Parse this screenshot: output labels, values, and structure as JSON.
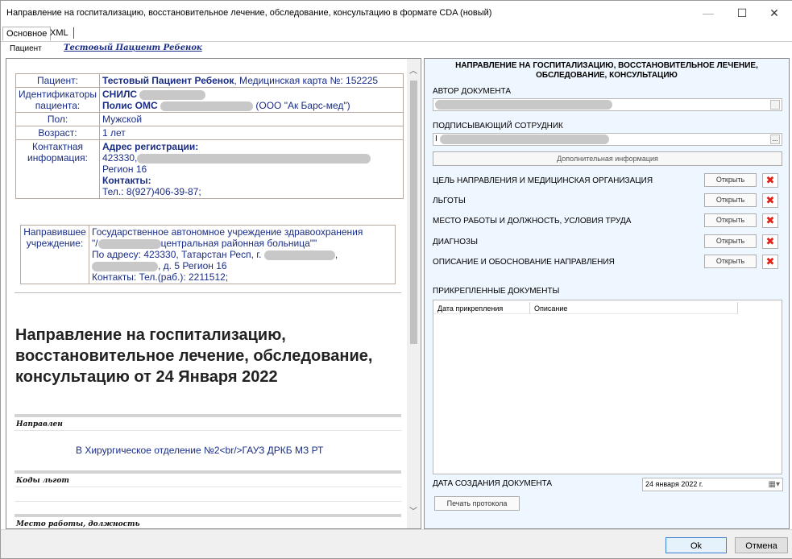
{
  "window": {
    "title": "Направление на госпитализацию, восстановительное лечение, обследование, консультацию в формате CDA (новый)",
    "controls": {
      "minimize": "—",
      "maximize": "☐",
      "close": "✕"
    }
  },
  "tabs": [
    {
      "label": "Основное",
      "active": true
    },
    {
      "label": "XML",
      "active": false
    }
  ],
  "patient_line": {
    "label": "Пациент",
    "value": "Тестовый Пациент Ребенок"
  },
  "left": {
    "patient_table": {
      "patient_key": "Пациент:",
      "patient_name": "Тестовый Пациент Ребенок",
      "patient_card": ", Медицинская карта №: 152225",
      "ids_key": "Идентификаторы пациента:",
      "snils": "СНИЛС",
      "oms": "Полис ОМС",
      "oms_org": "(ООО \"Ак Барс-мед\")",
      "sex_key": "Пол:",
      "sex": "Мужской",
      "age_key": "Возраст:",
      "age": "1 лет",
      "contact_key": "Контактная информация:",
      "addr_title": "Адрес регистрации:",
      "addr_zip": "423330,",
      "addr_region": "Регион 16",
      "contacts_title": "Контакты:",
      "phone": "Тел.: 8(927)406-39-87;"
    },
    "org_table": {
      "key": "Направившее учреждение:",
      "line1": "Государственное автономное учреждение здравоохранения",
      "line2_prefix": "\"/",
      "line2_suffix": "центральная районная больница\"\"",
      "line3": "По адресу: 423330, Татарстан Респ, г.",
      "line3_end": ",",
      "line4": ", д. 5 Регион 16",
      "line5": "Контакты: Тел.(раб.): 2211512;"
    },
    "big_title": "Направление на госпитализацию, восстановительное лечение, обследование, консультацию от 24 Января 2022",
    "sections": [
      {
        "heading": "Направлен",
        "text": "В Хирургическое отделение №2<br/>ГАУЗ ДРКБ МЗ РТ"
      },
      {
        "heading": "Коды льгот",
        "text": ""
      },
      {
        "heading": "Место работы, должность",
        "text": ""
      }
    ]
  },
  "right": {
    "heading": "НАПРАВЛЕНИЕ НА ГОСПИТАЛИЗАЦИЮ, ВОССТАНОВИТЕЛЬНОЕ ЛЕЧЕНИЕ, ОБСЛЕДОВАНИЕ, КОНСУЛЬТАЦИЮ",
    "author_label": "АВТОР ДОКУМЕНТА",
    "signer_label": "ПОДПИСЫВАЮЩИЙ СОТРУДНИК",
    "signer_prefix": "I",
    "ellipsis": "...",
    "additional_info": "Дополнительная информация",
    "rows": [
      {
        "label": "ЦЕЛЬ НАПРАВЛЕНИЯ И МЕДИЦИНСКАЯ ОРГАНИЗАЦИЯ",
        "open": "Открыть"
      },
      {
        "label": "ЛЬГОТЫ",
        "open": "Открыть"
      },
      {
        "label": "МЕСТО РАБОТЫ И ДОЛЖНОСТЬ, УСЛОВИЯ ТРУДА",
        "open": "Открыть"
      },
      {
        "label": "ДИАГНОЗЫ",
        "open": "Открыть"
      },
      {
        "label": "ОПИСАНИЕ И ОБОСНОВАНИЕ НАПРАВЛЕНИЯ",
        "open": "Открыть"
      }
    ],
    "attached_label": "ПРИКРЕПЛЕННЫЕ ДОКУМЕНТЫ",
    "attached_cols": [
      "Дата прикрепления",
      "Описание"
    ],
    "date_label": "ДАТА СОЗДАНИЯ ДОКУМЕНТА",
    "date_value": "24  января  2022 г.",
    "print_button": "Печать протокола"
  },
  "footer": {
    "ok": "Ok",
    "cancel": "Отмена"
  },
  "colors": {
    "link_blue": "#1a2d86",
    "delete_red": "#e2231a",
    "right_bg": "#eef6ff"
  }
}
